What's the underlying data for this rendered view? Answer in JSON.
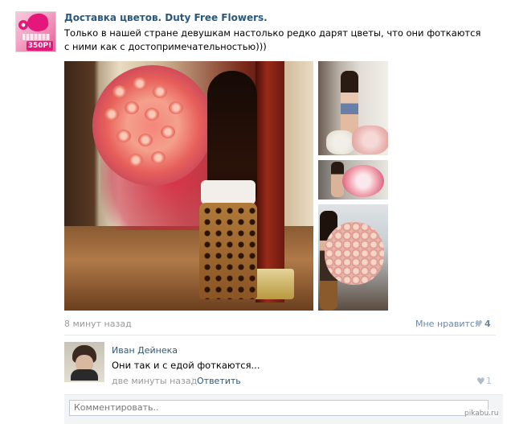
{
  "post": {
    "group_name": "Доставка цветов. Duty Free Flowers.",
    "avatar_price": "350Р!",
    "text": "Только в нашей стране девушкам настолько редко дарят цветы, что они фоткаются с ними как с достопримечательностью)))",
    "time_ago": "8 минут назад",
    "like_label": "Мне нравится",
    "like_icon": "heart-icon",
    "like_count": "4"
  },
  "comment": {
    "author": "Иван Дейнека",
    "text": "Они так и с едой фоткаются...",
    "time": "две минуты назад",
    "separator": "|",
    "reply_label": "Ответить",
    "like_icon": "heart-icon",
    "like_count": "1"
  },
  "reply_box": {
    "placeholder": "Комментировать.."
  },
  "watermark": "pikabu.ru",
  "colors": {
    "link": "#2b587a",
    "muted": "#999999",
    "like_blue": "#6a89a8",
    "divider": "#e7eaed"
  }
}
